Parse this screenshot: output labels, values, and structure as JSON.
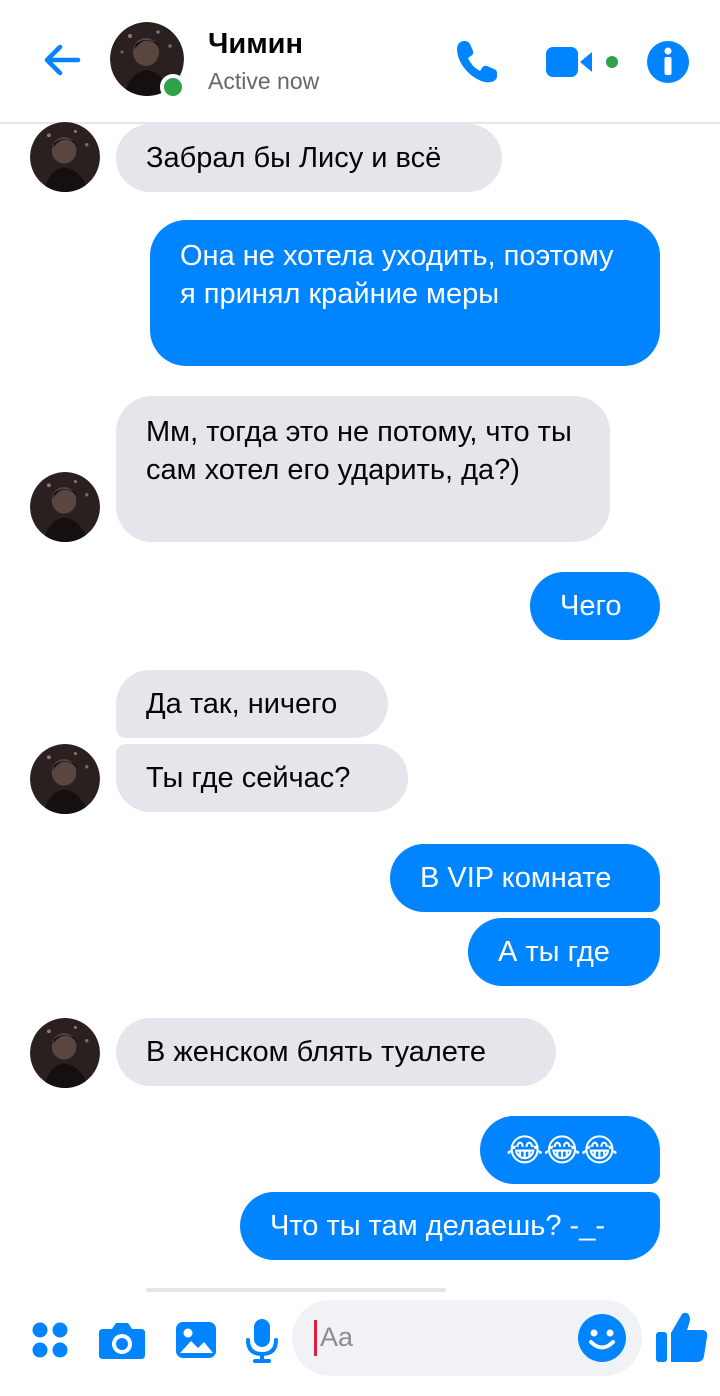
{
  "header": {
    "contact_name": "Чимин",
    "status": "Active now"
  },
  "messages": [
    {
      "side": "in",
      "text": "Забрал бы Лису и всё"
    },
    {
      "side": "out",
      "text": "Она не хотела уходить, поэтому я принял крайние меры"
    },
    {
      "side": "in",
      "text": "Мм, тогда это не потому, что ты сам хотел его ударить, да?)"
    },
    {
      "side": "out",
      "text": "Чего"
    },
    {
      "side": "in",
      "text": "Да так, ничего"
    },
    {
      "side": "in",
      "text": "Ты где сейчас?"
    },
    {
      "side": "out",
      "text": "В VIP комнате"
    },
    {
      "side": "out",
      "text": "А ты где"
    },
    {
      "side": "in",
      "text": "В женском блять туалете"
    },
    {
      "side": "out",
      "text": "😂😂😂"
    },
    {
      "side": "out",
      "text": "Что ты там делаешь? -_-"
    }
  ],
  "composer": {
    "placeholder": "Aa"
  },
  "colors": {
    "accent": "#0084ff",
    "incoming_bubble": "#e4e6eb",
    "active_dot": "#31a24c"
  },
  "icons": [
    "back-arrow-icon",
    "phone-icon",
    "video-camera-icon",
    "info-icon",
    "apps-icon",
    "camera-icon",
    "gallery-icon",
    "microphone-icon",
    "emoji-icon",
    "thumbs-up-icon"
  ]
}
